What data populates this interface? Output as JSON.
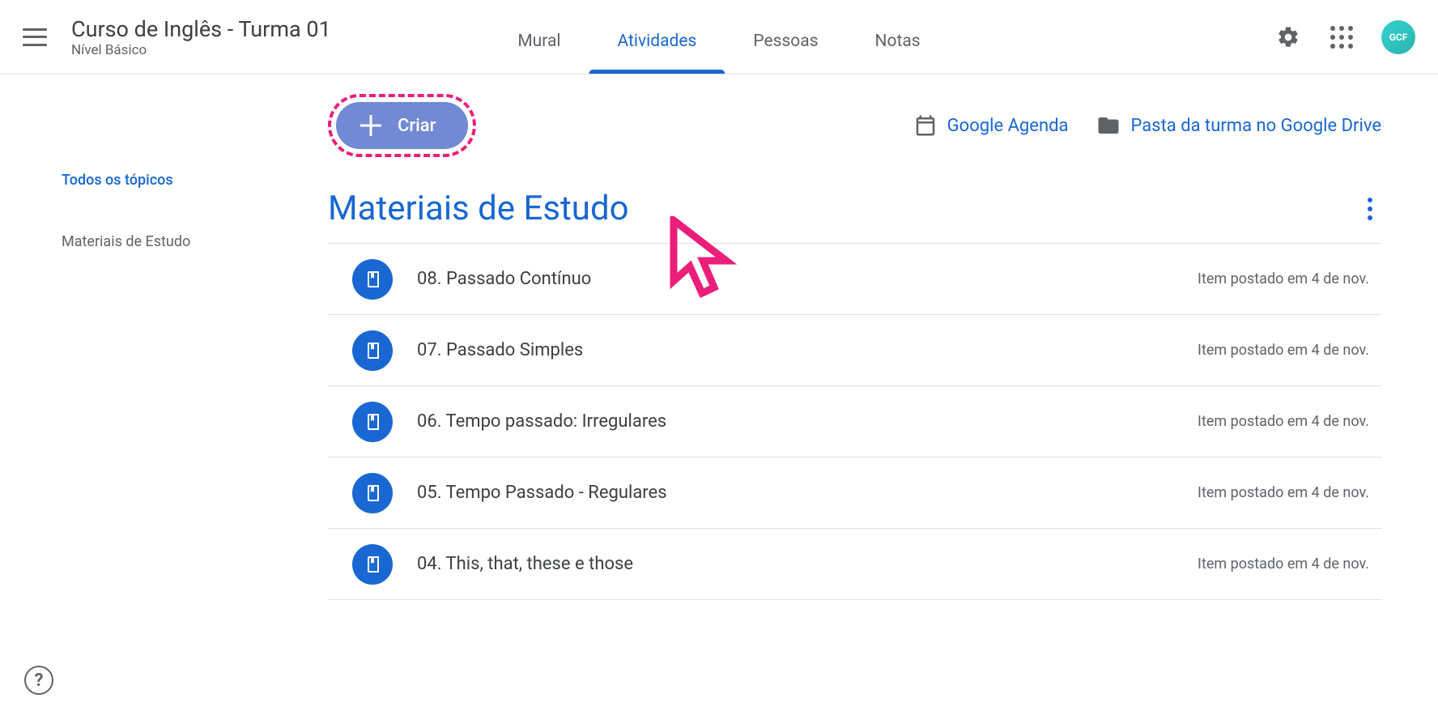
{
  "header": {
    "class_title": "Curso de Inglês - Turma 01",
    "class_sub": "Nível Básico",
    "tabs": [
      {
        "label": "Mural",
        "active": false
      },
      {
        "label": "Atividades",
        "active": true
      },
      {
        "label": "Pessoas",
        "active": false
      },
      {
        "label": "Notas",
        "active": false
      }
    ],
    "avatar_text": "GCF"
  },
  "sidebar": {
    "all_topics": "Todos os tópicos",
    "topics": [
      {
        "label": "Materiais de Estudo"
      }
    ]
  },
  "action_row": {
    "create_label": "Criar",
    "agenda_label": "Google Agenda",
    "drive_label": "Pasta da turma no Google Drive"
  },
  "topic": {
    "title": "Materiais de Estudo",
    "materials": [
      {
        "title": "08. Passado Contínuo",
        "date": "Item postado em 4 de nov."
      },
      {
        "title": "07. Passado Simples",
        "date": "Item postado em 4 de nov."
      },
      {
        "title": "06. Tempo passado: Irregulares",
        "date": "Item postado em 4 de nov."
      },
      {
        "title": "05. Tempo Passado - Regulares",
        "date": "Item postado em 4 de nov."
      },
      {
        "title": "04. This, that, these e those",
        "date": "Item postado em 4 de nov."
      }
    ]
  }
}
